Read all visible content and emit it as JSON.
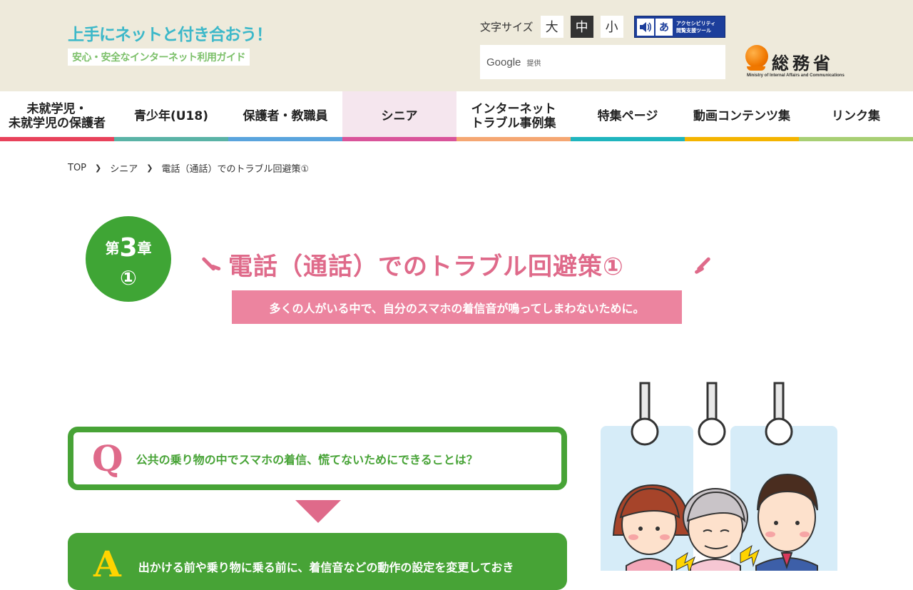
{
  "header": {
    "logo_title": "上手にネットと付き合おう！",
    "logo_subtitle": "安心・安全なインターネット利用ガイド",
    "fontsize_label": "文字サイズ",
    "fontsize_options": [
      "大",
      "中",
      "小"
    ],
    "fontsize_selected": "中",
    "accessibility_line1": "アクセシビリティ",
    "accessibility_line2": "閲覧支援ツール",
    "accessibility_icon": "あ",
    "search_brand": "Google",
    "search_provided": "提供",
    "ministry_name": "総務省",
    "ministry_en": "Ministry of Internal Affairs and Communications"
  },
  "nav": {
    "items": [
      {
        "label": "未就学児・\n未就学児の保護者",
        "color": "#e8425b"
      },
      {
        "label": "青少年(U18)",
        "color": "#5ab3a6"
      },
      {
        "label": "保護者・教職員",
        "color": "#5aa4dd"
      },
      {
        "label": "シニア",
        "color": "#d9549a"
      },
      {
        "label": "インターネット\nトラブル事例集",
        "color": "#f5a773"
      },
      {
        "label": "特集ページ",
        "color": "#1fb5be"
      },
      {
        "label": "動画コンテンツ集",
        "color": "#f4b400"
      },
      {
        "label": "リンク集",
        "color": "#a8cf74"
      }
    ],
    "active_index": 3
  },
  "breadcrumb": [
    "TOP",
    "シニア",
    "電話（通話）でのトラブル回避策①"
  ],
  "chapter": {
    "prefix": "第",
    "number": "3",
    "suffix": "章",
    "sub": "①"
  },
  "page_title": "電話（通話）でのトラブル回避策①",
  "page_subtitle": "多くの人がいる中で、自分のスマホの着信音が鳴ってしまわないために。",
  "qa": {
    "q_mark": "Q",
    "question": "公共の乗り物の中でスマホの着信、慌てないためにできることは？",
    "a_mark": "A",
    "answer": "出かける前や乗り物に乗る前に、着信音などの動作の設定を変更しておき"
  },
  "colors": {
    "accent_green": "#47a336",
    "accent_pink": "#df6a8a",
    "header_bg": "#eeeadb"
  }
}
